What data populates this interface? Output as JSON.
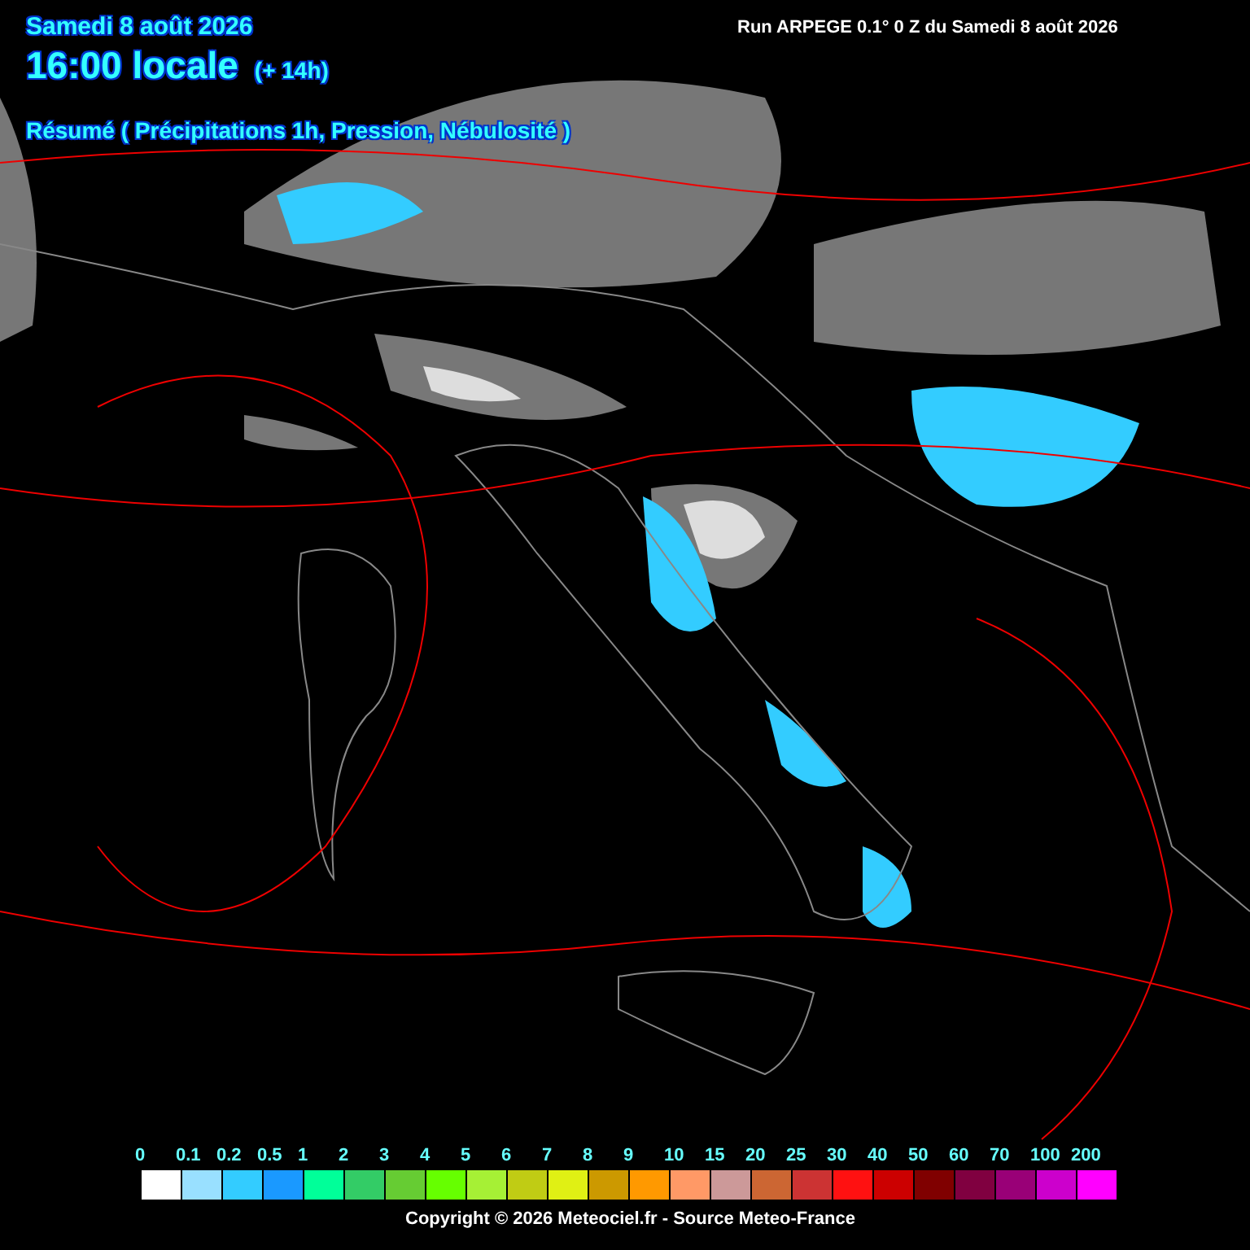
{
  "header": {
    "date": "Samedi 8 août 2026",
    "time": "16:00 locale",
    "offset": "(+ 14h)",
    "summary": "Résumé ( Précipitations 1h, Pression, Nébulosité )",
    "run": "Run ARPEGE 0.1° 0 Z du Samedi 8 août 2026"
  },
  "legend": [
    {
      "label": "0",
      "color": "#ffffff"
    },
    {
      "label": "0.1",
      "color": "#99e0ff"
    },
    {
      "label": "0.2",
      "color": "#33ccff"
    },
    {
      "label": "0.5",
      "color": "#1a99ff"
    },
    {
      "label": "1",
      "color": "#00ff99"
    },
    {
      "label": "2",
      "color": "#33cc66"
    },
    {
      "label": "3",
      "color": "#66cc33"
    },
    {
      "label": "4",
      "color": "#66ff00"
    },
    {
      "label": "5",
      "color": "#a6f035"
    },
    {
      "label": "6",
      "color": "#c0cc14"
    },
    {
      "label": "7",
      "color": "#e0f014"
    },
    {
      "label": "8",
      "color": "#cc9900"
    },
    {
      "label": "9",
      "color": "#ff9900"
    },
    {
      "label": "10",
      "color": "#ff9966"
    },
    {
      "label": "15",
      "color": "#cc9999"
    },
    {
      "label": "20",
      "color": "#cc6633"
    },
    {
      "label": "25",
      "color": "#cc3333"
    },
    {
      "label": "30",
      "color": "#ff1111"
    },
    {
      "label": "40",
      "color": "#cc0000"
    },
    {
      "label": "50",
      "color": "#800000"
    },
    {
      "label": "60",
      "color": "#800040"
    },
    {
      "label": "70",
      "color": "#990077"
    },
    {
      "label": "100",
      "color": "#cc00cc"
    },
    {
      "label": "200",
      "color": "#ff00ff"
    }
  ],
  "copyright": "Copyright © 2026 Meteociel.fr - Source Meteo-France"
}
